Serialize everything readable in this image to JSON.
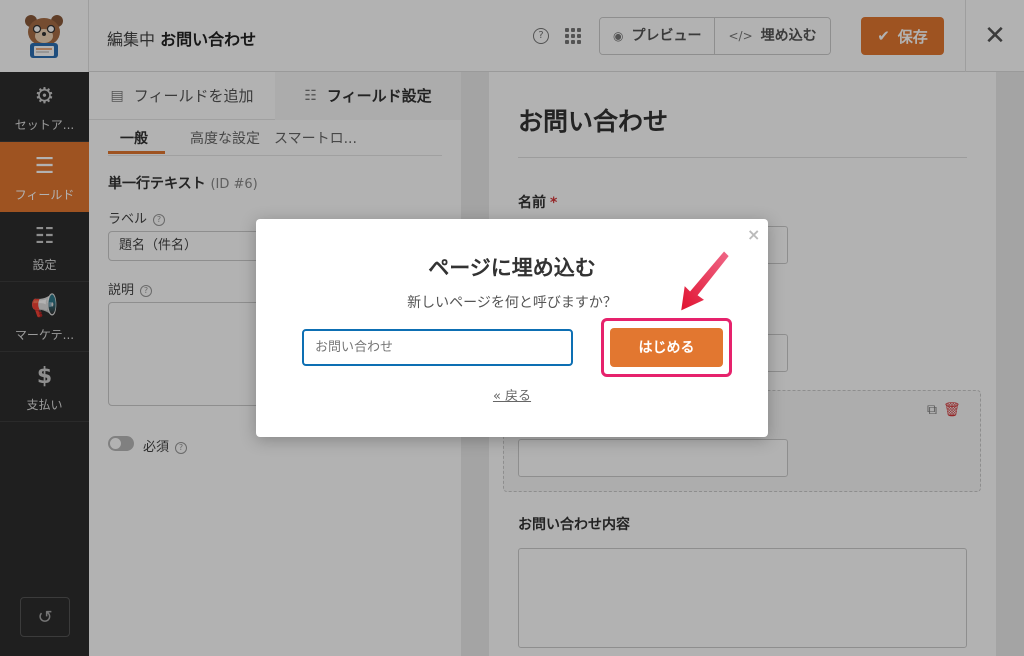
{
  "header": {
    "editing_prefix": "編集中",
    "form_name": "お問い合わせ",
    "help_icon": "question-circle-icon",
    "grid_icon": "grid-icon",
    "preview_label": "プレビュー",
    "embed_label": "埋め込む",
    "save_label": "保存",
    "close_icon": "close-icon"
  },
  "sidebar": {
    "items": [
      {
        "label": "セットア...",
        "icon": "gear-icon"
      },
      {
        "label": "フィールド",
        "icon": "list-icon",
        "active": true
      },
      {
        "label": "設定",
        "icon": "sliders-icon"
      },
      {
        "label": "マーケテ...",
        "icon": "megaphone-icon"
      },
      {
        "label": "支払い",
        "icon": "dollar-icon"
      }
    ],
    "history_icon": "history-icon"
  },
  "panel": {
    "tabs": [
      {
        "label": "フィールドを追加",
        "icon": "table-icon"
      },
      {
        "label": "フィールド設定",
        "icon": "sliders-icon",
        "active": true
      }
    ],
    "subtabs": [
      "一般",
      "高度な設定",
      "スマートロ..."
    ],
    "field_title": "単一行テキスト",
    "field_id": "(ID #6)",
    "label_label": "ラベル",
    "label_value": "題名（件名）",
    "description_label": "説明",
    "required_label": "必須"
  },
  "preview": {
    "form_title": "お問い合わせ",
    "name_label": "名前",
    "required_mark": "*",
    "message_label": "お問い合わせ内容"
  },
  "modal": {
    "title": "ページに埋め込む",
    "subtitle": "新しいページを何と呼びますか？",
    "input_value": "お問い合わせ",
    "start_button": "はじめる",
    "back_link": "« 戻る",
    "close_icon": "×"
  },
  "colors": {
    "accent": "#e27730",
    "highlight": "#e6226c",
    "input_focus": "#0d6fb3",
    "sidebar_bg": "#2d2d2d"
  }
}
